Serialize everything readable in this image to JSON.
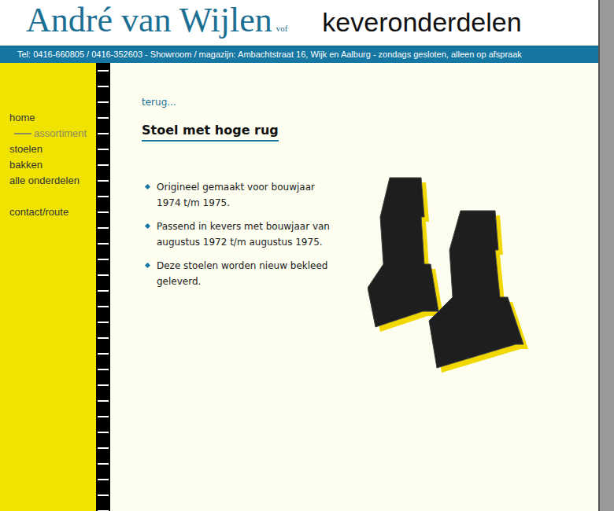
{
  "header": {
    "brand": "André van Wijlen",
    "suffix": "vof",
    "tagline": "keveronderdelen"
  },
  "info_bar": "Tel: 0416-660805 / 0416-352603 - Showroom / magazijn: Ambachtstraat 16, Wijk en Aalburg - zondags gesloten, alleen op afspraak",
  "sidebar": {
    "groups": [
      [
        {
          "label": "home",
          "kind": "link",
          "selected": false
        },
        {
          "label": "assortiment",
          "kind": "section",
          "selected": true
        },
        {
          "label": "stoelen",
          "kind": "link",
          "selected": false
        },
        {
          "label": "bakken",
          "kind": "link",
          "selected": false
        },
        {
          "label": "alle onderdelen",
          "kind": "link",
          "selected": false
        }
      ],
      [
        {
          "label": "contact/route",
          "kind": "link",
          "selected": false
        }
      ]
    ]
  },
  "content": {
    "back_link": "terug...",
    "title": "Stoel met hoge rug",
    "bullets": [
      "Origineel gemaakt voor bouwjaar 1974 t/m 1975.",
      "Passend in kevers met bouwjaar van augustus 1972 t/m augustus 1975.",
      "Deze stoelen worden nieuw bekleed geleverd."
    ]
  }
}
